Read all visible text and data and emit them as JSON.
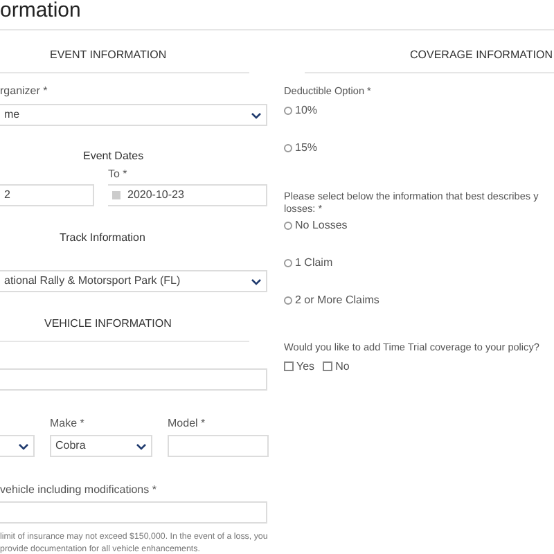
{
  "page_title": "ormation",
  "event_information": {
    "heading": "EVENT INFORMATION",
    "organizer": {
      "label": "rganizer *",
      "value": "me"
    },
    "event_dates": {
      "heading": "Event Dates",
      "from_value": "2",
      "to_label": "To *",
      "to_value": "2020-10-23"
    },
    "track": {
      "heading": "Track Information",
      "value": "ational Rally & Motorsport Park (FL)"
    }
  },
  "vehicle_information": {
    "heading": "VEHICLE INFORMATION",
    "make": {
      "label": "Make *",
      "value": "Cobra"
    },
    "model": {
      "label": "Model *"
    },
    "vehicle_value": {
      "label": "vehicle including modifications *"
    },
    "help_lines": [
      "limit of insurance may not exceed $150,000. In the event of a loss, you",
      "provide documentation for all vehicle enhancements."
    ]
  },
  "coverage_information": {
    "heading": "COVERAGE INFORMATION",
    "deductible": {
      "label": "Deductible Option *",
      "options": [
        {
          "label": "10%",
          "selected": false
        },
        {
          "label": "15%",
          "selected": false
        }
      ]
    },
    "losses": {
      "label_lines": [
        "Please select below the information that best describes y",
        "losses: *"
      ],
      "options": [
        {
          "label": "No Losses",
          "selected": false
        },
        {
          "label": "1 Claim",
          "selected": false
        },
        {
          "label": "2 or More Claims",
          "selected": false
        }
      ]
    },
    "time_trial": {
      "label": "Would you like to add Time Trial coverage to your policy?",
      "options": [
        {
          "label": "Yes",
          "checked": false
        },
        {
          "label": "No",
          "checked": false
        }
      ]
    }
  }
}
